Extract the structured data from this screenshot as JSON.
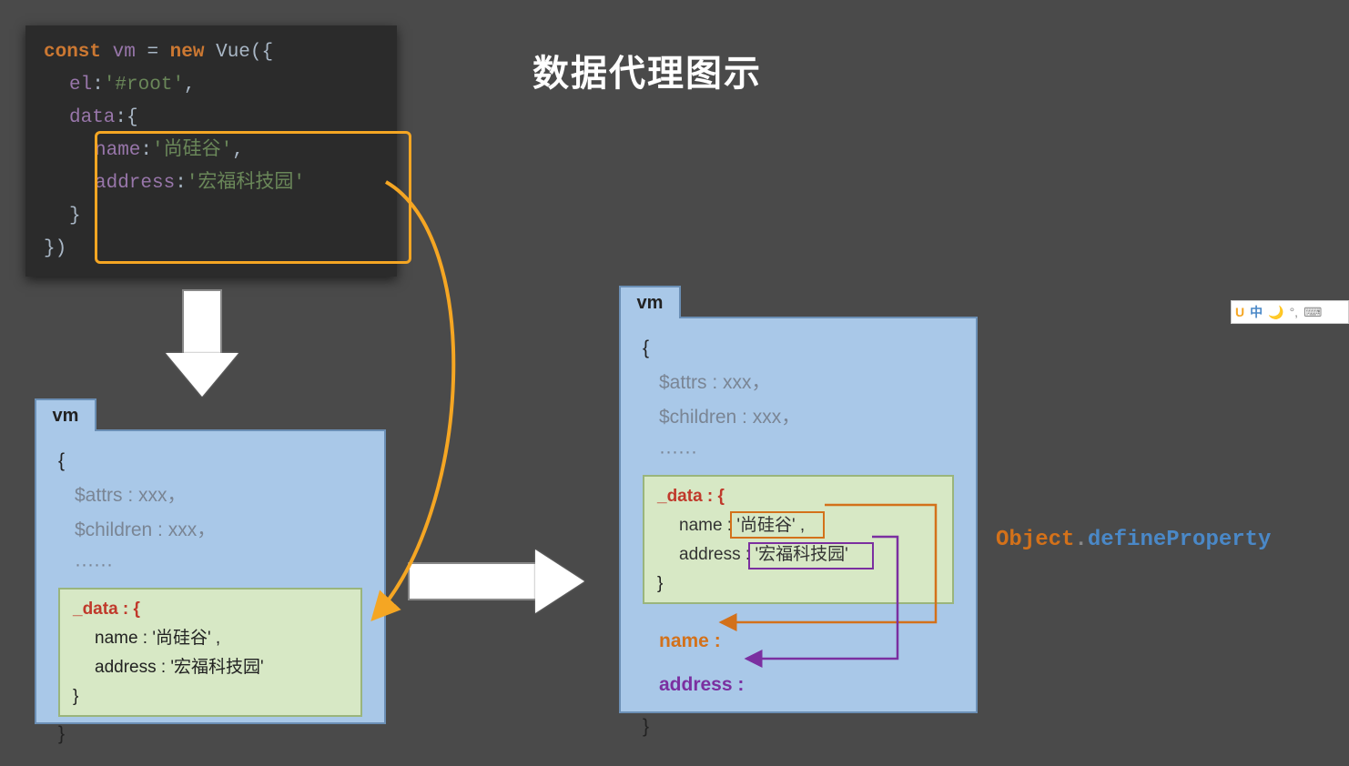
{
  "title": "数据代理图示",
  "code": {
    "kw_const": "const",
    "var_vm": "vm",
    "eq": "=",
    "kw_new": "new",
    "class_vue": "Vue",
    "open_paren_brace": "({",
    "el_key": "el",
    "el_val": "'#root'",
    "data_key": "data",
    "data_open": ":{",
    "name_key": "name",
    "name_val": "'尚硅谷'",
    "address_key": "address",
    "address_val": "'宏福科技园'",
    "data_close": "}",
    "close_brace_paren": "})"
  },
  "vm_left": {
    "tab": "vm",
    "open_brace": "{",
    "attrs": "$attrs : xxx，",
    "children": "$children : xxx，",
    "dots": "······",
    "data_label_u": "_",
    "data_label": "data : {",
    "name_line": "name : '尚硅谷' ,",
    "address_line": "address : '宏福科技园'",
    "data_close": "}",
    "close_brace": "}"
  },
  "vm_right": {
    "tab": "vm",
    "open_brace": "{",
    "attrs": "$attrs : xxx，",
    "children": "$children : xxx，",
    "dots": "······",
    "data_label_u": "_",
    "data_label": "data : {",
    "name_k": "name :",
    "name_v": "'尚硅谷' ,",
    "addr_k": "address :",
    "addr_v": "'宏福科技园'",
    "data_close": "}",
    "proxy_name": "name :",
    "proxy_addr": "address :",
    "close_brace": "}"
  },
  "odp": {
    "obj": "Object",
    "dot": ".",
    "fn": "defineProperty"
  },
  "ime": {
    "u": "U",
    "zh": "中",
    "moon": "🌙",
    "deg": "°,",
    "kb": "⌨"
  }
}
